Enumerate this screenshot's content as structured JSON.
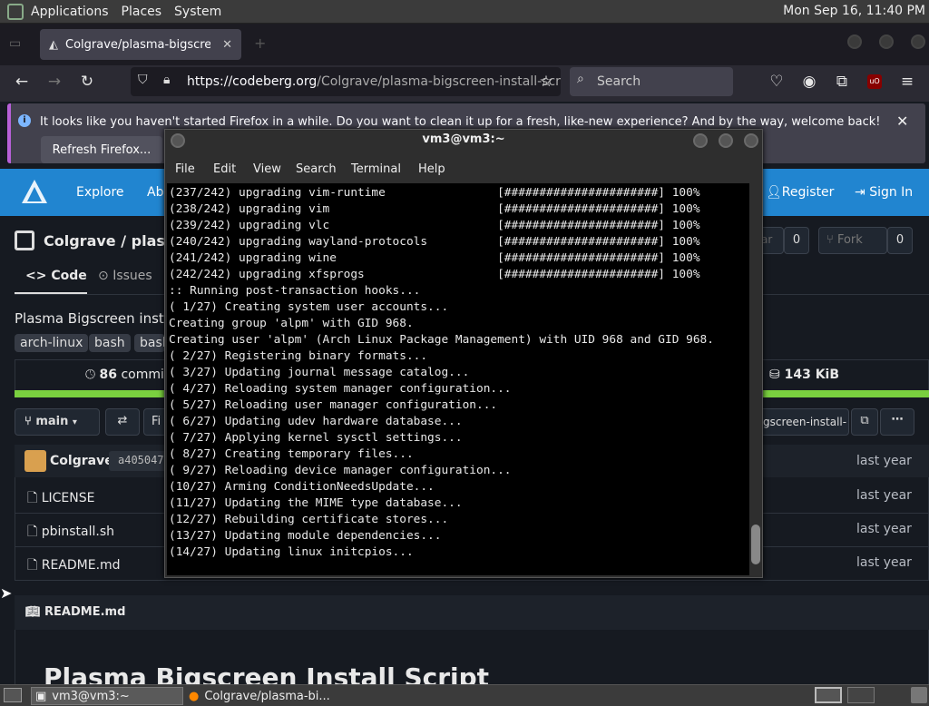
{
  "panel": {
    "menus": [
      "Applications",
      "Places",
      "System"
    ],
    "clock": "Mon Sep 16, 11:40 PM"
  },
  "browser": {
    "tab_title": "Colgrave/plasma-bigscreen",
    "url_prefix": "https://codeberg.org",
    "url_rest": "/Colgrave/plasma-bigscreen-install-scri",
    "search_placeholder": "Search",
    "notification": "It looks like you haven't started Firefox in a while. Do you want to clean it up for a fresh, like-new experience? And by the way, welcome back!",
    "refresh_button": "Refresh Firefox..."
  },
  "codeberg": {
    "nav": {
      "explore": "Explore",
      "about": "Abo",
      "register": "Register",
      "signin": "Sign In"
    },
    "repo_title": "Colgrave / plasma",
    "star_count": "0",
    "fork_label": "Fork",
    "fork_count": "0",
    "tabs": {
      "code": "Code",
      "issues": "Issues"
    },
    "description": "Plasma Bigscreen insta",
    "topics": [
      "arch-linux",
      "bash",
      "bash"
    ],
    "commits": "86",
    "commits_label": "commits",
    "size": "143 KiB",
    "branch": "main",
    "find_label": "Fi",
    "clone_url": "gscreen-install-",
    "committer": "Colgrave",
    "commit_hash": "a405047",
    "files": [
      {
        "name": "LICENSE",
        "date": "last year"
      },
      {
        "name": "pbinstall.sh",
        "date": "last year"
      },
      {
        "name": "README.md",
        "date": "last year"
      }
    ],
    "commit_date": "last year",
    "readme_label": "README.md",
    "readme_heading": "Plasma Bigscreen Install Script"
  },
  "terminal": {
    "title": "vm3@vm3:~",
    "menu": [
      "File",
      "Edit",
      "View",
      "Search",
      "Terminal",
      "Help"
    ],
    "lines": [
      "(237/242) upgrading vim-runtime                [######################] 100%",
      "(238/242) upgrading vim                        [######################] 100%",
      "(239/242) upgrading vlc                        [######################] 100%",
      "(240/242) upgrading wayland-protocols          [######################] 100%",
      "(241/242) upgrading wine                       [######################] 100%",
      "(242/242) upgrading xfsprogs                   [######################] 100%",
      ":: Running post-transaction hooks...",
      "( 1/27) Creating system user accounts...",
      "Creating group 'alpm' with GID 968.",
      "Creating user 'alpm' (Arch Linux Package Management) with UID 968 and GID 968.",
      "( 2/27) Registering binary formats...",
      "( 3/27) Updating journal message catalog...",
      "( 4/27) Reloading system manager configuration...",
      "( 5/27) Reloading user manager configuration...",
      "( 6/27) Updating udev hardware database...",
      "( 7/27) Applying kernel sysctl settings...",
      "( 8/27) Creating temporary files...",
      "( 9/27) Reloading device manager configuration...",
      "(10/27) Arming ConditionNeedsUpdate...",
      "(11/27) Updating the MIME type database...",
      "(12/27) Rebuilding certificate stores...",
      "(13/27) Updating module dependencies...",
      "(14/27) Updating linux initcpios..."
    ]
  },
  "taskbar": {
    "terminal_task": "vm3@vm3:~",
    "firefox_task": "Colgrave/plasma-bi..."
  }
}
